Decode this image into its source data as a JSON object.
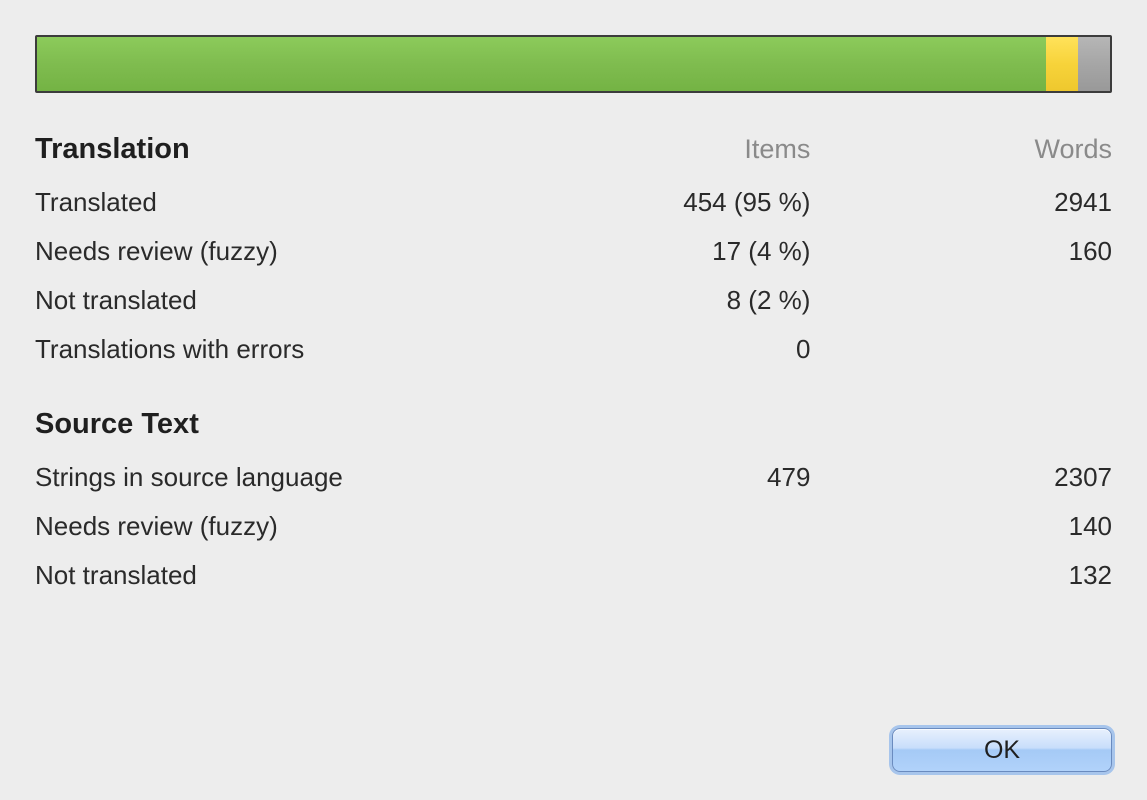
{
  "progress": {
    "translated_pct": 94,
    "fuzzy_pct": 3,
    "untranslated_pct": 3
  },
  "headers": {
    "items": "Items",
    "words": "Words"
  },
  "translation": {
    "title": "Translation",
    "rows": {
      "translated": {
        "label": "Translated",
        "items": "454 (95 %)",
        "words": "2941"
      },
      "fuzzy": {
        "label": "Needs review (fuzzy)",
        "items": "17 (4 %)",
        "words": "160"
      },
      "not_translated": {
        "label": "Not translated",
        "items": "8 (2 %)",
        "words": ""
      },
      "errors": {
        "label": "Translations with errors",
        "items": "0",
        "words": ""
      }
    }
  },
  "source": {
    "title": "Source Text",
    "rows": {
      "strings": {
        "label": "Strings in source language",
        "items": "479",
        "words": "2307"
      },
      "fuzzy": {
        "label": "Needs review (fuzzy)",
        "items": "",
        "words": "140"
      },
      "not_translated": {
        "label": "Not translated",
        "items": "",
        "words": "132"
      }
    }
  },
  "buttons": {
    "ok": "OK"
  }
}
